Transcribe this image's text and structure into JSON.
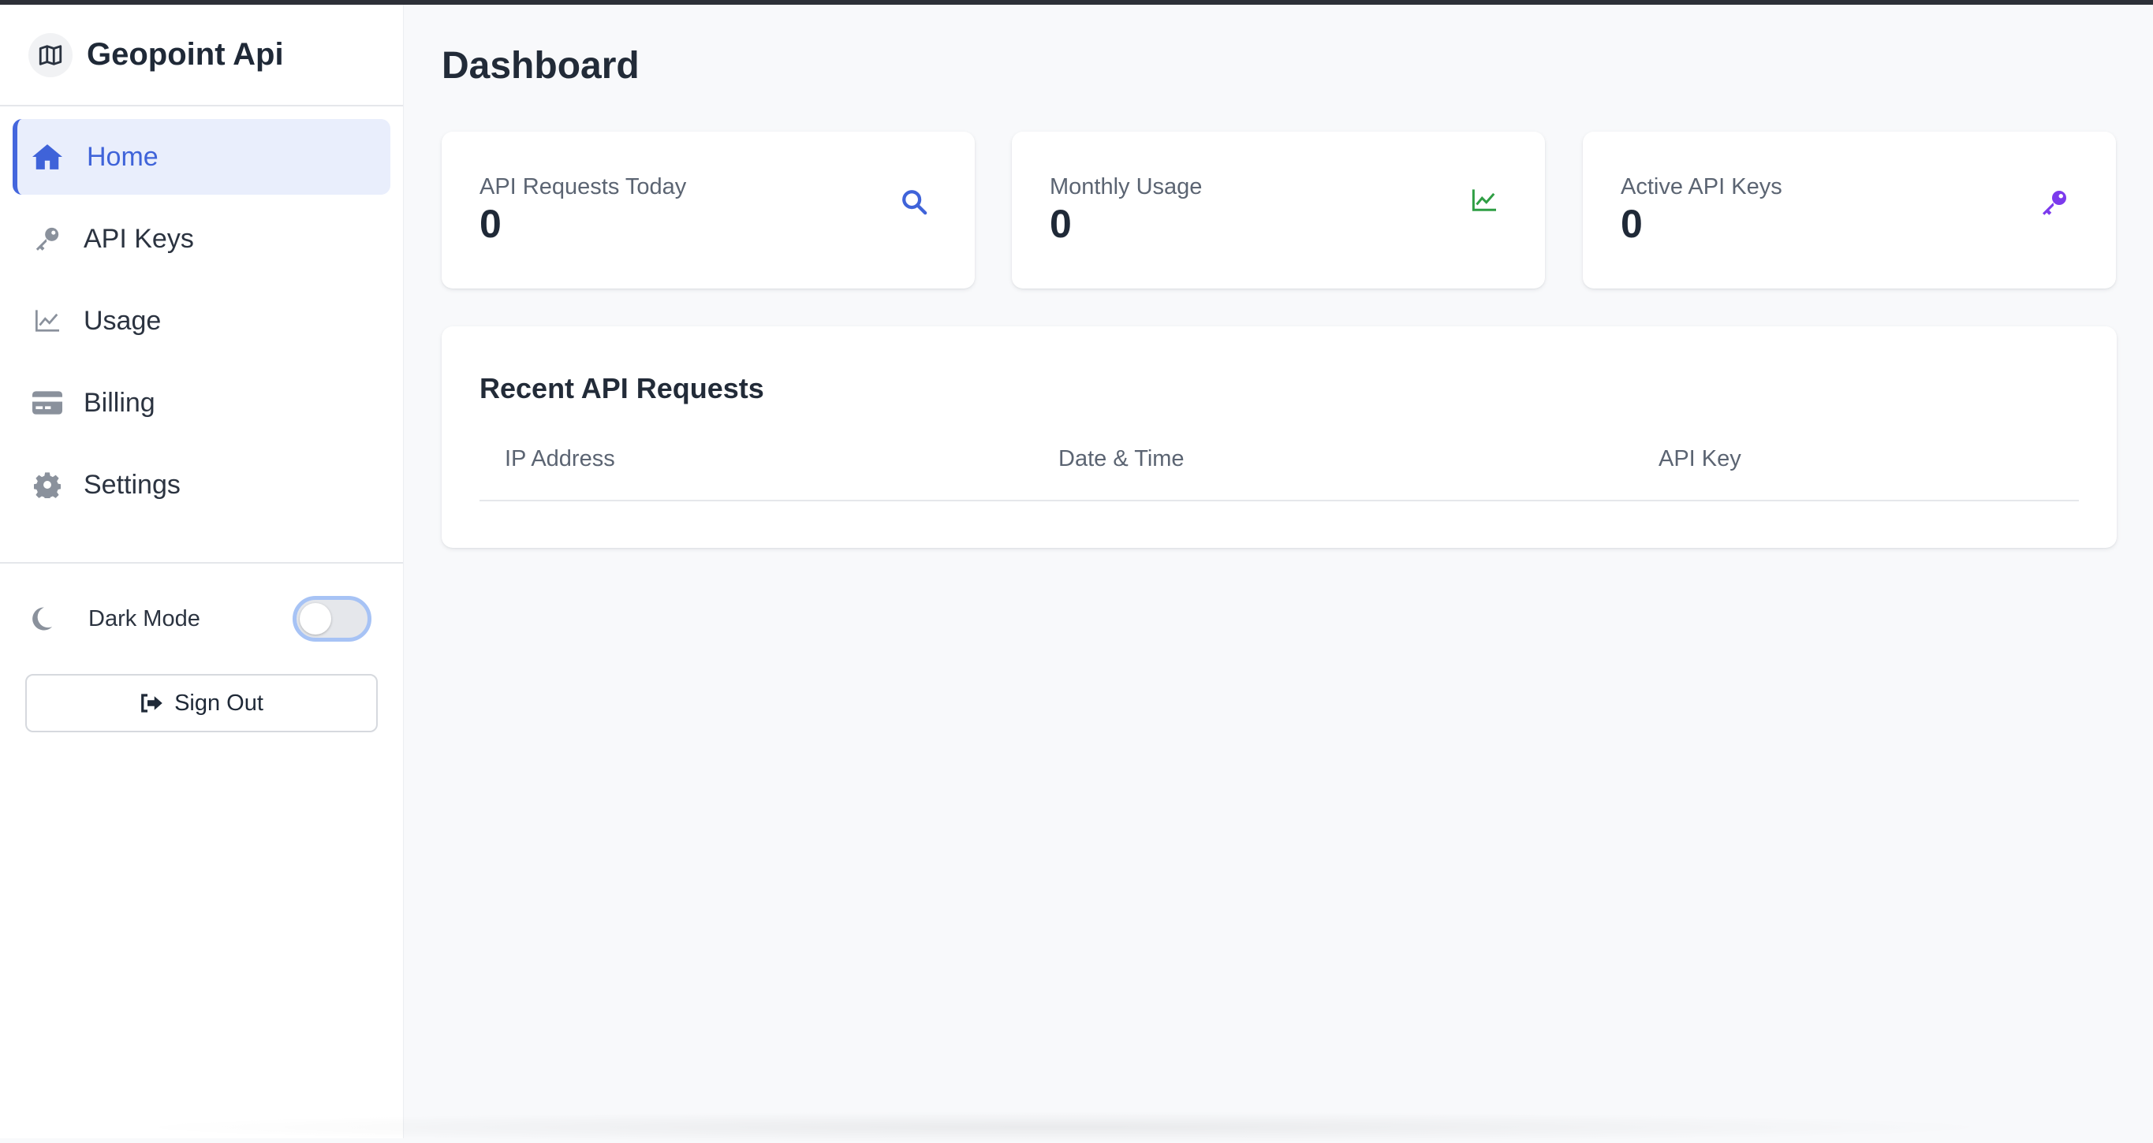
{
  "app": {
    "title": "Geopoint Api"
  },
  "sidebar": {
    "items": [
      {
        "label": "Home",
        "icon": "home-icon",
        "active": true
      },
      {
        "label": "API Keys",
        "icon": "key-icon",
        "active": false
      },
      {
        "label": "Usage",
        "icon": "chart-line-icon",
        "active": false
      },
      {
        "label": "Billing",
        "icon": "credit-card-icon",
        "active": false
      },
      {
        "label": "Settings",
        "icon": "gear-icon",
        "active": false
      }
    ],
    "dark_mode": {
      "label": "Dark Mode",
      "enabled": false
    },
    "sign_out_label": "Sign Out"
  },
  "main": {
    "title": "Dashboard",
    "stats": [
      {
        "label": "API Requests Today",
        "value": "0",
        "icon": "search-icon",
        "color": "#3f63d9"
      },
      {
        "label": "Monthly Usage",
        "value": "0",
        "icon": "chart-line-icon",
        "color": "#2f9e44"
      },
      {
        "label": "Active API Keys",
        "value": "0",
        "icon": "key-icon",
        "color": "#7c3aed"
      }
    ],
    "recent": {
      "title": "Recent API Requests",
      "columns": [
        "IP Address",
        "Date & Time",
        "API Key"
      ],
      "rows": []
    }
  },
  "colors": {
    "accent": "#3f63d9",
    "active_bg": "#e9eefc",
    "page_bg": "#f8f9fb"
  }
}
